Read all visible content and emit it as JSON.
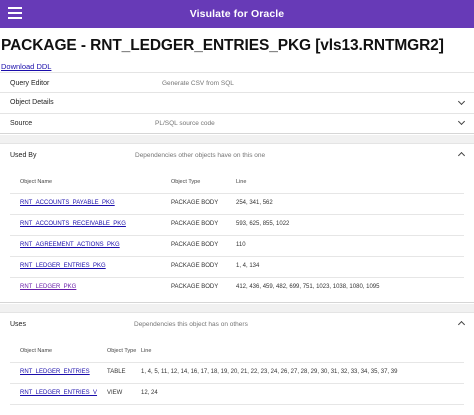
{
  "appbar": {
    "title": "Visulate for Oracle",
    "menu_icon": "menu-icon"
  },
  "page": {
    "title": "PACKAGE - RNT_LEDGER_ENTRIES_PKG [vls13.RNTMGR2]",
    "download_ddl": "Download DDL"
  },
  "panels": {
    "query_editor": {
      "label": "Query Editor",
      "sub": "Generate CSV from SQL"
    },
    "object_details": {
      "label": "Object Details"
    },
    "source": {
      "label": "Source",
      "sub": "PL/SQL source code"
    }
  },
  "used_by": {
    "label": "Used By",
    "sub": "Dependencies other objects have on this one",
    "headers": [
      "Object Name",
      "Object Type",
      "Line"
    ],
    "rows": [
      {
        "name": "RNT_ACCOUNTS_PAYABLE_PKG",
        "type": "PACKAGE BODY",
        "line": "254, 341, 562"
      },
      {
        "name": "RNT_ACCOUNTS_RECEIVABLE_PKG",
        "type": "PACKAGE BODY",
        "line": "593, 625, 855, 1022"
      },
      {
        "name": "RNT_AGREEMENT_ACTIONS_PKG",
        "type": "PACKAGE BODY",
        "line": "110"
      },
      {
        "name": "RNT_LEDGER_ENTRIES_PKG",
        "type": "PACKAGE BODY",
        "line": "1, 4, 134"
      },
      {
        "name": "RNT_LEDGER_PKG",
        "type": "PACKAGE BODY",
        "line": "412, 436, 459, 482, 699, 751, 1023, 1038, 1080, 1095"
      }
    ]
  },
  "uses": {
    "label": "Uses",
    "sub": "Dependencies this object has on others",
    "headers": [
      "Object Name",
      "Object Type",
      "Line"
    ],
    "rows": [
      {
        "name": "RNT_LEDGER_ENTRIES",
        "type": "TABLE",
        "line": "1, 4, 5, 11, 12, 14, 16, 17, 18, 19, 20, 21, 22, 23, 24, 26, 27, 28, 29, 30, 31, 32, 33, 34, 35, 37, 39"
      },
      {
        "name": "RNT_LEDGER_ENTRIES_V",
        "type": "VIEW",
        "line": "12, 24"
      }
    ]
  },
  "colors": {
    "appbar": "#673ab7",
    "link": "#1a0dab",
    "visited_link": "#681da8"
  }
}
